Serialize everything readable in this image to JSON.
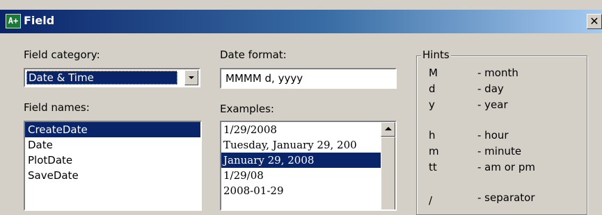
{
  "window": {
    "title": "Field",
    "close_glyph": "✕",
    "app_icon_glyph": "A+"
  },
  "field_category": {
    "label": "Field category:",
    "selected": "Date & Time"
  },
  "field_names": {
    "label": "Field names:",
    "items": [
      {
        "label": "CreateDate",
        "selected": true
      },
      {
        "label": "Date",
        "selected": false
      },
      {
        "label": "PlotDate",
        "selected": false
      },
      {
        "label": "SaveDate",
        "selected": false
      }
    ]
  },
  "date_format": {
    "label": "Date format:",
    "value": "MMMM d, yyyy"
  },
  "examples": {
    "label": "Examples:",
    "items": [
      {
        "label": "1/29/2008",
        "selected": false
      },
      {
        "label": "Tuesday, January 29, 200",
        "selected": false
      },
      {
        "label": "January 29, 2008",
        "selected": true
      },
      {
        "label": "1/29/08",
        "selected": false
      },
      {
        "label": "2008-01-29",
        "selected": false
      }
    ]
  },
  "hints": {
    "title": "Hints",
    "rows": [
      {
        "symbol": "M",
        "desc": "- month"
      },
      {
        "symbol": "d",
        "desc": "- day"
      },
      {
        "symbol": "y",
        "desc": "- year"
      },
      {
        "symbol": "h",
        "desc": "- hour"
      },
      {
        "symbol": "m",
        "desc": "- minute"
      },
      {
        "symbol": "tt",
        "desc": "- am or pm"
      },
      {
        "symbol": "/",
        "desc": "- separator"
      }
    ]
  },
  "colors": {
    "titlebar_start": "#0a246a",
    "titlebar_end": "#a6caf0",
    "selection": "#0a246a",
    "dialog_bg": "#d4d0c8"
  }
}
